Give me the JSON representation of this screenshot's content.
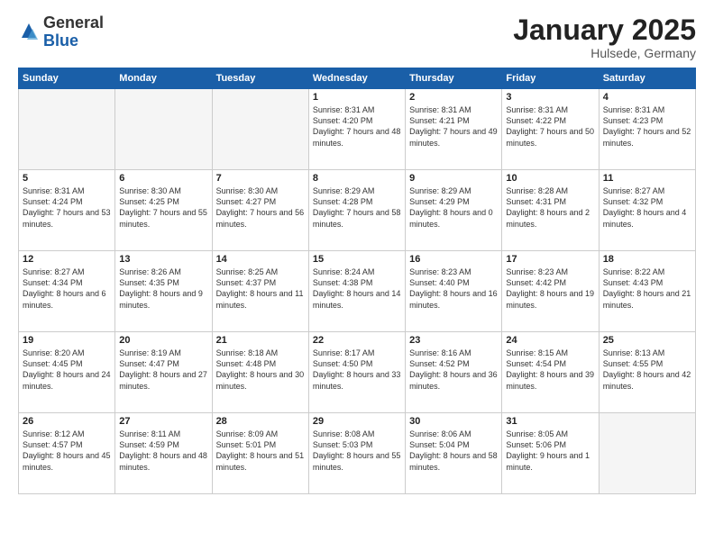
{
  "header": {
    "logo_general": "General",
    "logo_blue": "Blue",
    "month_title": "January 2025",
    "location": "Hulsede, Germany"
  },
  "days_of_week": [
    "Sunday",
    "Monday",
    "Tuesday",
    "Wednesday",
    "Thursday",
    "Friday",
    "Saturday"
  ],
  "weeks": [
    [
      {
        "day": "",
        "empty": true
      },
      {
        "day": "",
        "empty": true
      },
      {
        "day": "",
        "empty": true
      },
      {
        "day": "1",
        "sunrise": "Sunrise: 8:31 AM",
        "sunset": "Sunset: 4:20 PM",
        "daylight": "Daylight: 7 hours and 48 minutes."
      },
      {
        "day": "2",
        "sunrise": "Sunrise: 8:31 AM",
        "sunset": "Sunset: 4:21 PM",
        "daylight": "Daylight: 7 hours and 49 minutes."
      },
      {
        "day": "3",
        "sunrise": "Sunrise: 8:31 AM",
        "sunset": "Sunset: 4:22 PM",
        "daylight": "Daylight: 7 hours and 50 minutes."
      },
      {
        "day": "4",
        "sunrise": "Sunrise: 8:31 AM",
        "sunset": "Sunset: 4:23 PM",
        "daylight": "Daylight: 7 hours and 52 minutes."
      }
    ],
    [
      {
        "day": "5",
        "sunrise": "Sunrise: 8:31 AM",
        "sunset": "Sunset: 4:24 PM",
        "daylight": "Daylight: 7 hours and 53 minutes."
      },
      {
        "day": "6",
        "sunrise": "Sunrise: 8:30 AM",
        "sunset": "Sunset: 4:25 PM",
        "daylight": "Daylight: 7 hours and 55 minutes."
      },
      {
        "day": "7",
        "sunrise": "Sunrise: 8:30 AM",
        "sunset": "Sunset: 4:27 PM",
        "daylight": "Daylight: 7 hours and 56 minutes."
      },
      {
        "day": "8",
        "sunrise": "Sunrise: 8:29 AM",
        "sunset": "Sunset: 4:28 PM",
        "daylight": "Daylight: 7 hours and 58 minutes."
      },
      {
        "day": "9",
        "sunrise": "Sunrise: 8:29 AM",
        "sunset": "Sunset: 4:29 PM",
        "daylight": "Daylight: 8 hours and 0 minutes."
      },
      {
        "day": "10",
        "sunrise": "Sunrise: 8:28 AM",
        "sunset": "Sunset: 4:31 PM",
        "daylight": "Daylight: 8 hours and 2 minutes."
      },
      {
        "day": "11",
        "sunrise": "Sunrise: 8:27 AM",
        "sunset": "Sunset: 4:32 PM",
        "daylight": "Daylight: 8 hours and 4 minutes."
      }
    ],
    [
      {
        "day": "12",
        "sunrise": "Sunrise: 8:27 AM",
        "sunset": "Sunset: 4:34 PM",
        "daylight": "Daylight: 8 hours and 6 minutes."
      },
      {
        "day": "13",
        "sunrise": "Sunrise: 8:26 AM",
        "sunset": "Sunset: 4:35 PM",
        "daylight": "Daylight: 8 hours and 9 minutes."
      },
      {
        "day": "14",
        "sunrise": "Sunrise: 8:25 AM",
        "sunset": "Sunset: 4:37 PM",
        "daylight": "Daylight: 8 hours and 11 minutes."
      },
      {
        "day": "15",
        "sunrise": "Sunrise: 8:24 AM",
        "sunset": "Sunset: 4:38 PM",
        "daylight": "Daylight: 8 hours and 14 minutes."
      },
      {
        "day": "16",
        "sunrise": "Sunrise: 8:23 AM",
        "sunset": "Sunset: 4:40 PM",
        "daylight": "Daylight: 8 hours and 16 minutes."
      },
      {
        "day": "17",
        "sunrise": "Sunrise: 8:23 AM",
        "sunset": "Sunset: 4:42 PM",
        "daylight": "Daylight: 8 hours and 19 minutes."
      },
      {
        "day": "18",
        "sunrise": "Sunrise: 8:22 AM",
        "sunset": "Sunset: 4:43 PM",
        "daylight": "Daylight: 8 hours and 21 minutes."
      }
    ],
    [
      {
        "day": "19",
        "sunrise": "Sunrise: 8:20 AM",
        "sunset": "Sunset: 4:45 PM",
        "daylight": "Daylight: 8 hours and 24 minutes."
      },
      {
        "day": "20",
        "sunrise": "Sunrise: 8:19 AM",
        "sunset": "Sunset: 4:47 PM",
        "daylight": "Daylight: 8 hours and 27 minutes."
      },
      {
        "day": "21",
        "sunrise": "Sunrise: 8:18 AM",
        "sunset": "Sunset: 4:48 PM",
        "daylight": "Daylight: 8 hours and 30 minutes."
      },
      {
        "day": "22",
        "sunrise": "Sunrise: 8:17 AM",
        "sunset": "Sunset: 4:50 PM",
        "daylight": "Daylight: 8 hours and 33 minutes."
      },
      {
        "day": "23",
        "sunrise": "Sunrise: 8:16 AM",
        "sunset": "Sunset: 4:52 PM",
        "daylight": "Daylight: 8 hours and 36 minutes."
      },
      {
        "day": "24",
        "sunrise": "Sunrise: 8:15 AM",
        "sunset": "Sunset: 4:54 PM",
        "daylight": "Daylight: 8 hours and 39 minutes."
      },
      {
        "day": "25",
        "sunrise": "Sunrise: 8:13 AM",
        "sunset": "Sunset: 4:55 PM",
        "daylight": "Daylight: 8 hours and 42 minutes."
      }
    ],
    [
      {
        "day": "26",
        "sunrise": "Sunrise: 8:12 AM",
        "sunset": "Sunset: 4:57 PM",
        "daylight": "Daylight: 8 hours and 45 minutes."
      },
      {
        "day": "27",
        "sunrise": "Sunrise: 8:11 AM",
        "sunset": "Sunset: 4:59 PM",
        "daylight": "Daylight: 8 hours and 48 minutes."
      },
      {
        "day": "28",
        "sunrise": "Sunrise: 8:09 AM",
        "sunset": "Sunset: 5:01 PM",
        "daylight": "Daylight: 8 hours and 51 minutes."
      },
      {
        "day": "29",
        "sunrise": "Sunrise: 8:08 AM",
        "sunset": "Sunset: 5:03 PM",
        "daylight": "Daylight: 8 hours and 55 minutes."
      },
      {
        "day": "30",
        "sunrise": "Sunrise: 8:06 AM",
        "sunset": "Sunset: 5:04 PM",
        "daylight": "Daylight: 8 hours and 58 minutes."
      },
      {
        "day": "31",
        "sunrise": "Sunrise: 8:05 AM",
        "sunset": "Sunset: 5:06 PM",
        "daylight": "Daylight: 9 hours and 1 minute."
      },
      {
        "day": "",
        "empty": true
      }
    ]
  ]
}
